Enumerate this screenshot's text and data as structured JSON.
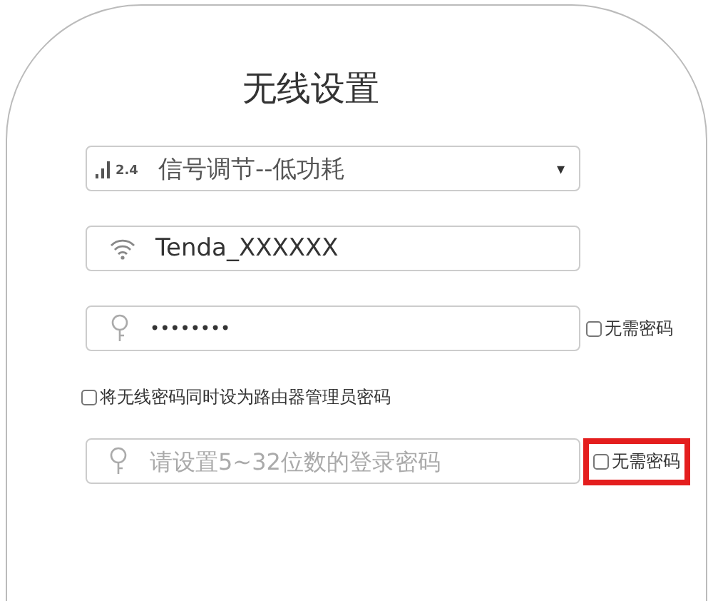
{
  "title": "无线设置",
  "fields": [
    {
      "kind": "select",
      "band": "2.4",
      "value": "信号调节--低功耗",
      "caret": "▾"
    },
    {
      "kind": "text",
      "value": "Tenda_XXXXXX"
    },
    {
      "kind": "password",
      "value": "••••••••",
      "no_password": {
        "label": "无需密码",
        "checked": false,
        "highlighted": false
      }
    }
  ],
  "admin_same": {
    "label": "将无线密码同时设为路由器管理员密码",
    "checked": false
  },
  "login": {
    "placeholder": "请设置5~32位数的登录密码",
    "no_password": {
      "label": "无需密码",
      "checked": false,
      "highlighted": true
    }
  }
}
